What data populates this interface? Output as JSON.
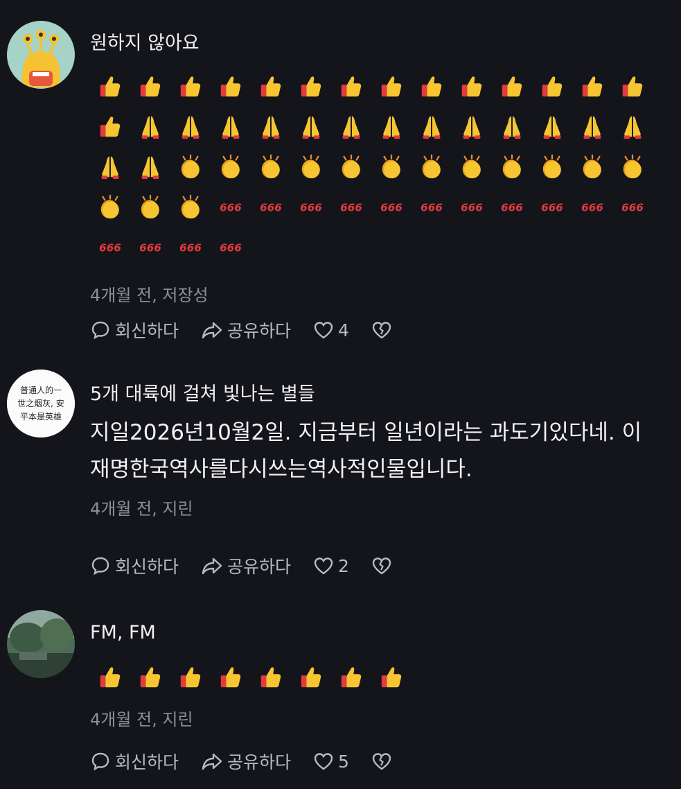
{
  "comments": [
    {
      "username": "원하지 않아요",
      "emojis": [
        "thumbs",
        "thumbs",
        "thumbs",
        "thumbs",
        "thumbs",
        "thumbs",
        "thumbs",
        "thumbs",
        "thumbs",
        "thumbs",
        "thumbs",
        "thumbs",
        "thumbs",
        "thumbs",
        "thumbs",
        "pray",
        "pray",
        "pray",
        "pray",
        "pray",
        "pray",
        "pray",
        "pray",
        "pray",
        "pray",
        "pray",
        "pray",
        "pray",
        "pray",
        "pray",
        "clap",
        "clap",
        "clap",
        "clap",
        "clap",
        "clap",
        "clap",
        "clap",
        "clap",
        "clap",
        "clap",
        "clap",
        "clap",
        "clap",
        "clap",
        "666",
        "666",
        "666",
        "666",
        "666",
        "666",
        "666",
        "666",
        "666",
        "666",
        "666",
        "666",
        "666",
        "666",
        "666"
      ],
      "meta": "4개월 전, 저장성",
      "reply_label": "회신하다",
      "share_label": "공유하다",
      "likes": "4"
    },
    {
      "username": "5개 대륙에 걸쳐 빛나는 별들",
      "text_lines": [
        "지일2026년10월2일. 지금부터 일년이라는 과도기있다네. 이",
        "재명한국역사를다시쓰는역사적인물입니다."
      ],
      "avatar_text": [
        "普通人的一",
        "世之烟灰, 安",
        "平本是英雄"
      ],
      "meta": "4개월 전, 지린",
      "reply_label": "회신하다",
      "share_label": "공유하다",
      "likes": "2"
    },
    {
      "username": "FM, FM",
      "emojis": [
        "thumbs",
        "thumbs",
        "thumbs",
        "thumbs",
        "thumbs",
        "thumbs",
        "thumbs",
        "thumbs"
      ],
      "meta": "4개월 전, 지린",
      "reply_label": "회신하다",
      "share_label": "공유하다",
      "likes": "5"
    }
  ],
  "icons": {
    "reply": "reply-bubble-icon",
    "share": "share-arrow-icon",
    "like": "heart-icon",
    "dislike": "broken-heart-icon"
  },
  "colors": {
    "background": "#14151b",
    "emoji_yellow": "#f6c531",
    "emoji_red": "#e23a3f"
  }
}
